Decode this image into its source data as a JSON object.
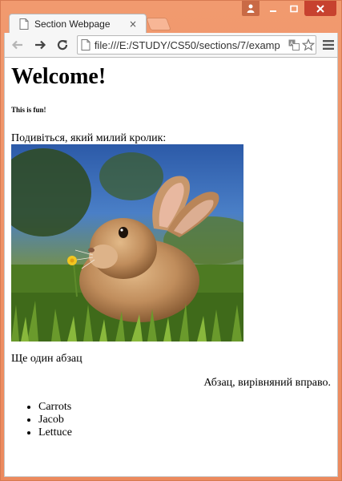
{
  "window": {
    "controls": [
      "user-icon",
      "minimize-icon",
      "maximize-icon",
      "close-icon"
    ]
  },
  "tab": {
    "title": "Section Webpage",
    "close_glyph": "×"
  },
  "toolbar": {
    "url": "file:///E:/STUDY/CS50/sections/7/examp",
    "icons": [
      "back-arrow-icon",
      "forward-arrow-icon",
      "reload-icon",
      "translate-icon",
      "star-icon",
      "menu-icon"
    ]
  },
  "page": {
    "heading": "Welcome!",
    "subheading": "This is fun!",
    "paragraph1": "Подивіться, який милий кролик:",
    "image_subject": "bunny",
    "paragraph2": "Ще один абзац",
    "paragraph3": "Абзац, вирівняний вправо.",
    "list": [
      "Carrots",
      "Jacob",
      "Lettuce"
    ]
  },
  "colors": {
    "window_frame": "#f0926a",
    "close_button": "#c7422f",
    "toolbar_bg": "#f6f6f6"
  }
}
